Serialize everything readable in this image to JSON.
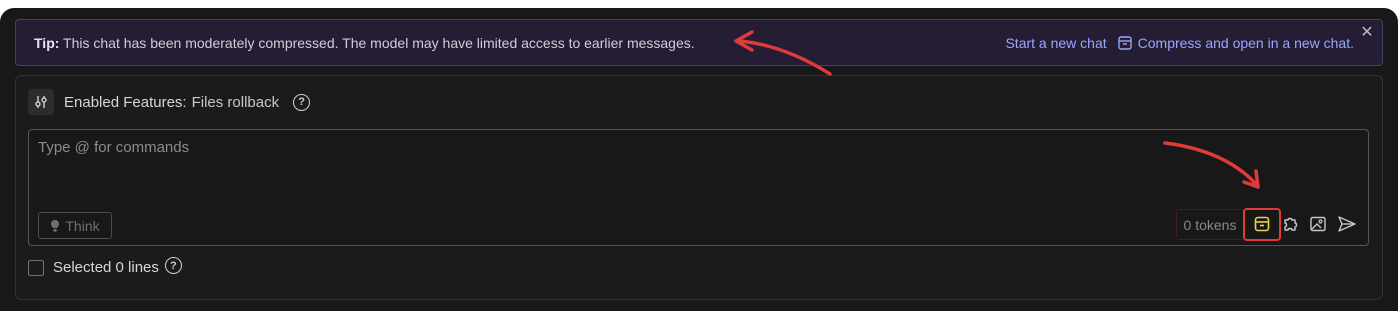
{
  "tip": {
    "label": "Tip:",
    "message": "This chat has been moderately compressed. The model may have limited access to earlier messages.",
    "start_new_chat": "Start a new chat",
    "compress_open": "Compress and open in a new chat.",
    "close_icon": "close-icon"
  },
  "features": {
    "label": "Enabled Features:",
    "value": "Files rollback",
    "icon": "sliders-icon"
  },
  "input": {
    "placeholder": "Type @ for commands",
    "think_label": "Think",
    "tokens_label": "0 tokens"
  },
  "selection": {
    "label": "Selected 0 lines"
  },
  "colors": {
    "background": "#181818",
    "tip_background": "#241d33",
    "link": "#9aa6ff",
    "highlight": "#e03a3a",
    "archive_icon": "#e8d24a"
  }
}
